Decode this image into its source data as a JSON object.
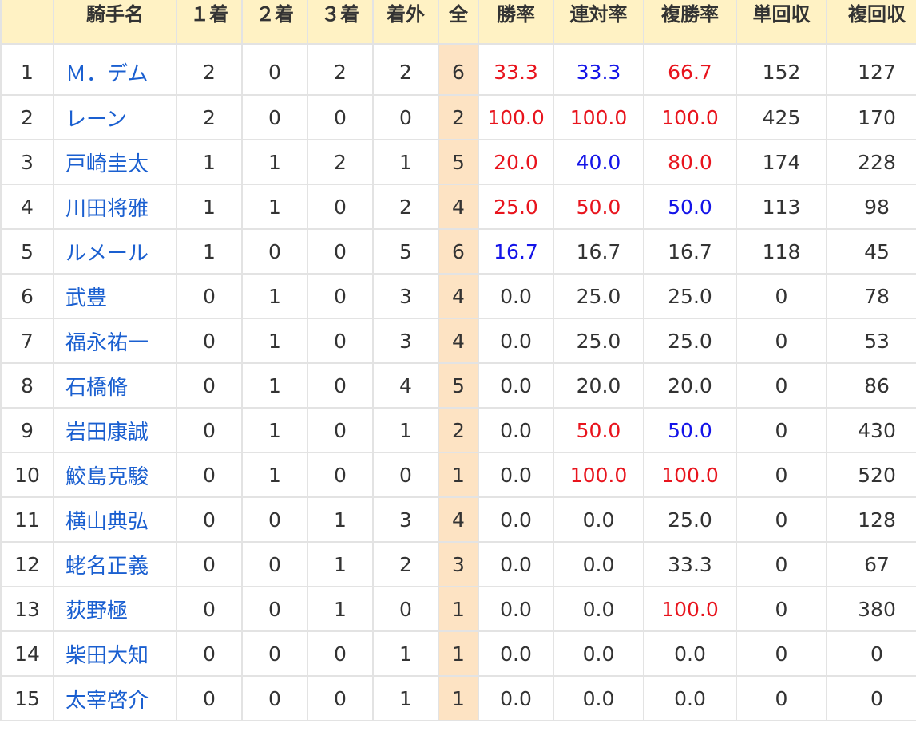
{
  "table": {
    "headers": {
      "rank": "",
      "name": "騎手名",
      "first": "１着",
      "second": "２着",
      "third": "３着",
      "out": "着外",
      "all": "全",
      "win_rate": "勝率",
      "place_rate": "連対率",
      "show_rate": "複勝率",
      "win_return": "単回収",
      "show_return": "複回収"
    },
    "highlight_colors": {
      "red": "#e8141d",
      "blue": "#1414e8",
      "link": "#1a5fd0",
      "header_bg": "#fff2c4",
      "all_col_bg": "#fde3c3"
    },
    "rows": [
      {
        "rank": "1",
        "name": "Ｍ．デム",
        "first": "2",
        "second": "0",
        "third": "2",
        "out": "2",
        "all": "6",
        "win_rate": "33.3",
        "place_rate": "33.3",
        "show_rate": "66.7",
        "win_return": "152",
        "show_return": "127"
      },
      {
        "rank": "2",
        "name": "レーン",
        "first": "2",
        "second": "0",
        "third": "0",
        "out": "0",
        "all": "2",
        "win_rate": "100.0",
        "place_rate": "100.0",
        "show_rate": "100.0",
        "win_return": "425",
        "show_return": "170"
      },
      {
        "rank": "3",
        "name": "戸崎圭太",
        "first": "1",
        "second": "1",
        "third": "2",
        "out": "1",
        "all": "5",
        "win_rate": "20.0",
        "place_rate": "40.0",
        "show_rate": "80.0",
        "win_return": "174",
        "show_return": "228"
      },
      {
        "rank": "4",
        "name": "川田将雅",
        "first": "1",
        "second": "1",
        "third": "0",
        "out": "2",
        "all": "4",
        "win_rate": "25.0",
        "place_rate": "50.0",
        "show_rate": "50.0",
        "win_return": "113",
        "show_return": "98"
      },
      {
        "rank": "5",
        "name": "ルメール",
        "first": "1",
        "second": "0",
        "third": "0",
        "out": "5",
        "all": "6",
        "win_rate": "16.7",
        "place_rate": "16.7",
        "show_rate": "16.7",
        "win_return": "118",
        "show_return": "45"
      },
      {
        "rank": "6",
        "name": "武豊",
        "first": "0",
        "second": "1",
        "third": "0",
        "out": "3",
        "all": "4",
        "win_rate": "0.0",
        "place_rate": "25.0",
        "show_rate": "25.0",
        "win_return": "0",
        "show_return": "78"
      },
      {
        "rank": "7",
        "name": "福永祐一",
        "first": "0",
        "second": "1",
        "third": "0",
        "out": "3",
        "all": "4",
        "win_rate": "0.0",
        "place_rate": "25.0",
        "show_rate": "25.0",
        "win_return": "0",
        "show_return": "53"
      },
      {
        "rank": "8",
        "name": "石橋脩",
        "first": "0",
        "second": "1",
        "third": "0",
        "out": "4",
        "all": "5",
        "win_rate": "0.0",
        "place_rate": "20.0",
        "show_rate": "20.0",
        "win_return": "0",
        "show_return": "86"
      },
      {
        "rank": "9",
        "name": "岩田康誠",
        "first": "0",
        "second": "1",
        "third": "0",
        "out": "1",
        "all": "2",
        "win_rate": "0.0",
        "place_rate": "50.0",
        "show_rate": "50.0",
        "win_return": "0",
        "show_return": "430"
      },
      {
        "rank": "10",
        "name": "鮫島克駿",
        "first": "0",
        "second": "1",
        "third": "0",
        "out": "0",
        "all": "1",
        "win_rate": "0.0",
        "place_rate": "100.0",
        "show_rate": "100.0",
        "win_return": "0",
        "show_return": "520"
      },
      {
        "rank": "11",
        "name": "横山典弘",
        "first": "0",
        "second": "0",
        "third": "1",
        "out": "3",
        "all": "4",
        "win_rate": "0.0",
        "place_rate": "0.0",
        "show_rate": "25.0",
        "win_return": "0",
        "show_return": "128"
      },
      {
        "rank": "12",
        "name": "蛯名正義",
        "first": "0",
        "second": "0",
        "third": "1",
        "out": "2",
        "all": "3",
        "win_rate": "0.0",
        "place_rate": "0.0",
        "show_rate": "33.3",
        "win_return": "0",
        "show_return": "67"
      },
      {
        "rank": "13",
        "name": "荻野極",
        "first": "0",
        "second": "0",
        "third": "1",
        "out": "0",
        "all": "1",
        "win_rate": "0.0",
        "place_rate": "0.0",
        "show_rate": "100.0",
        "win_return": "0",
        "show_return": "380"
      },
      {
        "rank": "14",
        "name": "柴田大知",
        "first": "0",
        "second": "0",
        "third": "0",
        "out": "1",
        "all": "1",
        "win_rate": "0.0",
        "place_rate": "0.0",
        "show_rate": "0.0",
        "win_return": "0",
        "show_return": "0"
      },
      {
        "rank": "15",
        "name": "太宰啓介",
        "first": "0",
        "second": "0",
        "third": "0",
        "out": "1",
        "all": "1",
        "win_rate": "0.0",
        "place_rate": "0.0",
        "show_rate": "0.0",
        "win_return": "0",
        "show_return": "0"
      }
    ]
  }
}
